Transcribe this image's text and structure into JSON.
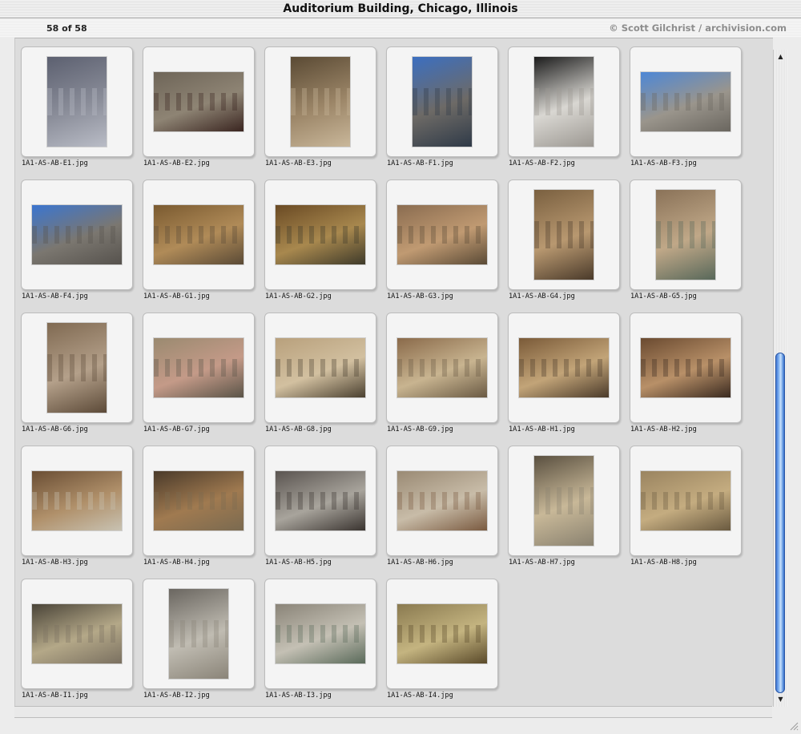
{
  "window": {
    "title": "Auditorium Building, Chicago, Illinois"
  },
  "status": {
    "count": "58 of 58",
    "credit": "© Scott Gilchrist / archivision.com"
  },
  "thumbnails": [
    {
      "file": "1A1-AS-AB-E1.jpg",
      "orientation": "portrait",
      "colors": [
        "#5c6070",
        "#8a8d99",
        "#b9bcc6"
      ]
    },
    {
      "file": "1A1-AS-AB-E2.jpg",
      "orientation": "landscape",
      "colors": [
        "#6e6558",
        "#8e8474",
        "#3a2520"
      ]
    },
    {
      "file": "1A1-AS-AB-E3.jpg",
      "orientation": "portrait",
      "colors": [
        "#5a4a34",
        "#9c8668",
        "#c9b79a"
      ]
    },
    {
      "file": "1A1-AS-AB-F1.jpg",
      "orientation": "portrait",
      "colors": [
        "#3c6fc0",
        "#6d6a66",
        "#2f3a48"
      ]
    },
    {
      "file": "1A1-AS-AB-F2.jpg",
      "orientation": "portrait",
      "colors": [
        "#1c1c1c",
        "#d9d7d2",
        "#9c9892"
      ]
    },
    {
      "file": "1A1-AS-AB-F3.jpg",
      "orientation": "landscape",
      "colors": [
        "#4d87d6",
        "#9a958c",
        "#6a665f"
      ]
    },
    {
      "file": "1A1-AS-AB-F4.jpg",
      "orientation": "landscape",
      "colors": [
        "#3b75cf",
        "#7b7770",
        "#56524d"
      ]
    },
    {
      "file": "1A1-AS-AB-G1.jpg",
      "orientation": "landscape",
      "colors": [
        "#7a5a30",
        "#b08b58",
        "#5a4a36"
      ]
    },
    {
      "file": "1A1-AS-AB-G2.jpg",
      "orientation": "landscape",
      "colors": [
        "#6a4a24",
        "#a8884e",
        "#3e3a2a"
      ]
    },
    {
      "file": "1A1-AS-AB-G3.jpg",
      "orientation": "landscape",
      "colors": [
        "#8a6c50",
        "#c09a72",
        "#5a4a36"
      ]
    },
    {
      "file": "1A1-AS-AB-G4.jpg",
      "orientation": "portrait",
      "colors": [
        "#7a6040",
        "#b89870",
        "#4a3a2a"
      ]
    },
    {
      "file": "1A1-AS-AB-G5.jpg",
      "orientation": "portrait",
      "colors": [
        "#8a7258",
        "#c0a888",
        "#58685a"
      ]
    },
    {
      "file": "1A1-AS-AB-G6.jpg",
      "orientation": "portrait",
      "colors": [
        "#806a52",
        "#b4a08a",
        "#5c4a38"
      ]
    },
    {
      "file": "1A1-AS-AB-G7.jpg",
      "orientation": "landscape",
      "colors": [
        "#9a8a70",
        "#c49a88",
        "#5a5448"
      ]
    },
    {
      "file": "1A1-AS-AB-G8.jpg",
      "orientation": "landscape",
      "colors": [
        "#b8a07c",
        "#d2c0a0",
        "#4a4030"
      ]
    },
    {
      "file": "1A1-AS-AB-G9.jpg",
      "orientation": "landscape",
      "colors": [
        "#8a6a4a",
        "#c8b490",
        "#6a5a44"
      ]
    },
    {
      "file": "1A1-AS-AB-H1.jpg",
      "orientation": "landscape",
      "colors": [
        "#7a5a38",
        "#c2a478",
        "#4a3a2a"
      ]
    },
    {
      "file": "1A1-AS-AB-H2.jpg",
      "orientation": "landscape",
      "colors": [
        "#6a4a30",
        "#b89068",
        "#3a2a20"
      ]
    },
    {
      "file": "1A1-AS-AB-H3.jpg",
      "orientation": "landscape",
      "colors": [
        "#6a4e34",
        "#b0906a",
        "#c8c2b2"
      ]
    },
    {
      "file": "1A1-AS-AB-H4.jpg",
      "orientation": "landscape",
      "colors": [
        "#4a3a2a",
        "#a07a50",
        "#7a6a50"
      ]
    },
    {
      "file": "1A1-AS-AB-H5.jpg",
      "orientation": "landscape",
      "colors": [
        "#5a5450",
        "#a8a49c",
        "#3a3430"
      ]
    },
    {
      "file": "1A1-AS-AB-H6.jpg",
      "orientation": "landscape",
      "colors": [
        "#9a8a74",
        "#c8bca8",
        "#7a5a40"
      ]
    },
    {
      "file": "1A1-AS-AB-H7.jpg",
      "orientation": "portrait",
      "colors": [
        "#5a5040",
        "#c8b898",
        "#8a8270"
      ]
    },
    {
      "file": "1A1-AS-AB-H8.jpg",
      "orientation": "landscape",
      "colors": [
        "#9a8460",
        "#c4ac80",
        "#6a5a40"
      ]
    },
    {
      "file": "1A1-AS-AB-I1.jpg",
      "orientation": "landscape",
      "colors": [
        "#4a4438",
        "#b4a888",
        "#7a7060"
      ]
    },
    {
      "file": "1A1-AS-AB-I2.jpg",
      "orientation": "portrait",
      "colors": [
        "#6a6660",
        "#c0bcb2",
        "#8a8478"
      ]
    },
    {
      "file": "1A1-AS-AB-I3.jpg",
      "orientation": "landscape",
      "colors": [
        "#8a8478",
        "#c4c0b4",
        "#5a6a5a"
      ]
    },
    {
      "file": "1A1-AS-AB-I4.jpg",
      "orientation": "landscape",
      "colors": [
        "#8a7a50",
        "#c4b480",
        "#5a4a2a"
      ]
    }
  ],
  "scrollbar": {
    "position": 0.62
  }
}
